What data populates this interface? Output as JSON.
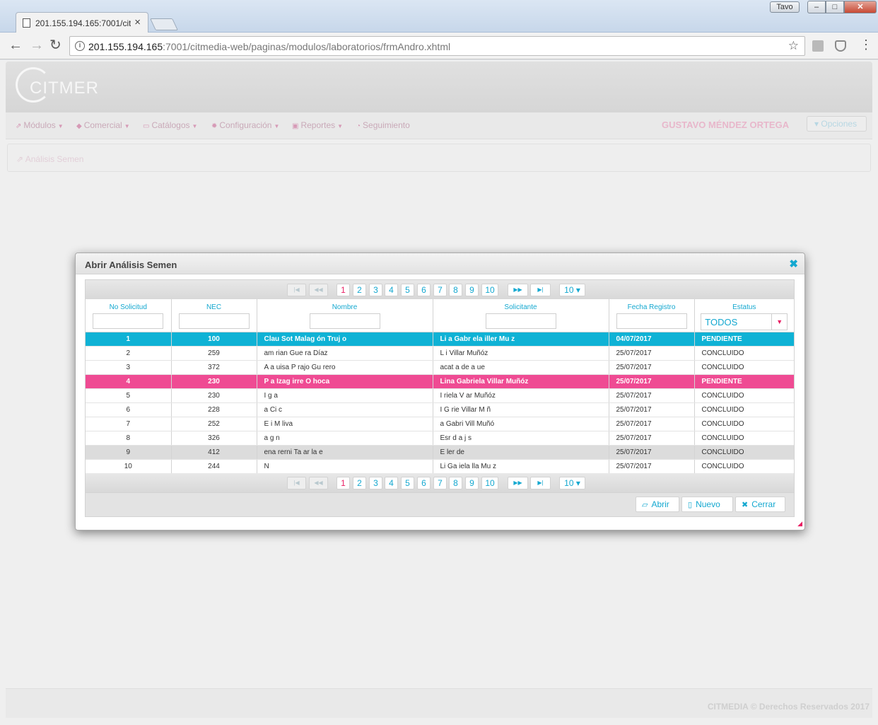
{
  "browser": {
    "tab_title": "201.155.194.165:7001/cit",
    "url_host": "201.155.194.165",
    "url_rest": ":7001/citmedia-web/paginas/modulos/laboratorios/frmAndro.xhtml",
    "user_chip": "Tavo"
  },
  "app": {
    "logo_text": "CITMER",
    "menu": [
      "Módulos",
      "Comercial",
      "Catálogos",
      "Configuración",
      "Reportes",
      "Seguimiento"
    ],
    "user_name": "GUSTAVO MÉNDEZ ORTEGA",
    "options_label": "Opciones",
    "breadcrumb": "Análisis Semen",
    "footer": "CITMEDIA © Derechos Reservados 2017"
  },
  "dialog": {
    "title": "Abrir Análisis Semen",
    "pages": [
      "1",
      "2",
      "3",
      "4",
      "5",
      "6",
      "7",
      "8",
      "9",
      "10"
    ],
    "rows_per_page": "10 ▾",
    "columns": [
      "No Solicitud",
      "NEC",
      "Nombre",
      "Solicitante",
      "Fecha Registro",
      "Estatus"
    ],
    "status_filter_value": "TODOS",
    "rows": [
      {
        "no": "1",
        "nec": "100",
        "nombre": "Clau   Sot  Malag  ón Truj  o",
        "solicitante": "Li  a Gabr  ela  iller Mu  z",
        "fecha": "04/07/2017",
        "estatus": "PENDIENTE"
      },
      {
        "no": "2",
        "nec": "259",
        "nombre": "  am  rian  Gue  ra Díaz",
        "solicitante": "L      i    Villar Muñóz",
        "fecha": "25/07/2017",
        "estatus": "CONCLUIDO"
      },
      {
        "no": "3",
        "nec": "372",
        "nombre": "A  a  uisa P  rajo Gu  rero",
        "solicitante": "     acat  a de  a  ue",
        "fecha": "25/07/2017",
        "estatus": "CONCLUIDO"
      },
      {
        "no": "4",
        "nec": "230",
        "nombre": "P   a Izag  irre O  hoca",
        "solicitante": "Lina Gabriela Villar Muñóz",
        "fecha": "25/07/2017",
        "estatus": "PENDIENTE"
      },
      {
        "no": "5",
        "nec": "230",
        "nombre": "I        g         a",
        "solicitante": "I      riela V  ar Muñóz",
        "fecha": "25/07/2017",
        "estatus": "CONCLUIDO"
      },
      {
        "no": "6",
        "nec": "228",
        "nombre": "    a   Ci  c",
        "solicitante": "I   G  rie  Villar M  ñ",
        "fecha": "25/07/2017",
        "estatus": "CONCLUIDO"
      },
      {
        "no": "7",
        "nec": "252",
        "nombre": "E    i   M       liva",
        "solicitante": "  a Gabri  Vill  Muñó",
        "fecha": "25/07/2017",
        "estatus": "CONCLUIDO"
      },
      {
        "no": "8",
        "nec": "326",
        "nombre": "  a           g                n",
        "solicitante": "    Esr    d         a  j  s",
        "fecha": "25/07/2017",
        "estatus": "CONCLUIDO"
      },
      {
        "no": "9",
        "nec": "412",
        "nombre": "  ena   rerni   Ta   ar  la   e",
        "solicitante": "    E   ler  de",
        "fecha": "25/07/2017",
        "estatus": "CONCLUIDO"
      },
      {
        "no": "10",
        "nec": "244",
        "nombre": "N                 ",
        "solicitante": "Li  Ga  iela   lla  Mu  z",
        "fecha": "25/07/2017",
        "estatus": "CONCLUIDO"
      }
    ],
    "buttons": {
      "open": "Abrir",
      "new": "Nuevo",
      "close": "Cerrar"
    }
  }
}
